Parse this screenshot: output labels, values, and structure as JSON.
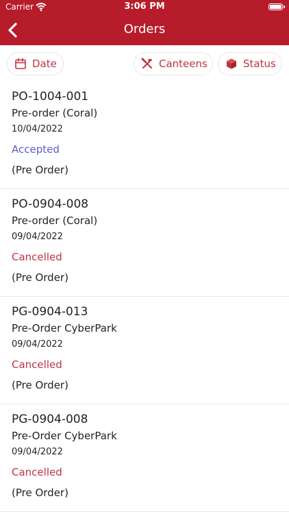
{
  "status_bar": {
    "carrier": "Carrier",
    "time": "3:06 PM"
  },
  "nav": {
    "title": "Orders",
    "back_icon": "chevron-left-icon"
  },
  "filters": [
    {
      "label": "Date",
      "icon": "calendar-icon"
    },
    {
      "label": "Canteens",
      "icon": "utensils-icon"
    },
    {
      "label": "Status",
      "icon": "box-icon"
    }
  ],
  "orders": [
    {
      "number": "PO-1004-001",
      "canteen": "Pre-order (Coral)",
      "date": "10/04/2022",
      "status": "Accepted",
      "type": "(Pre Order)"
    },
    {
      "number": "PO-0904-008",
      "canteen": "Pre-order (Coral)",
      "date": "09/04/2022",
      "status": "Cancelled",
      "type": "(Pre Order)"
    },
    {
      "number": "PG-0904-013",
      "canteen": "Pre-Order CyberPark",
      "date": "09/04/2022",
      "status": "Cancelled",
      "type": "(Pre Order)"
    },
    {
      "number": "PG-0904-008",
      "canteen": "Pre-Order CyberPark",
      "date": "09/04/2022",
      "status": "Cancelled",
      "type": "(Pre Order)"
    }
  ],
  "colors": {
    "brand": "#b71c2a",
    "accepted": "#5c5fcb",
    "cancelled": "#c0323f"
  }
}
